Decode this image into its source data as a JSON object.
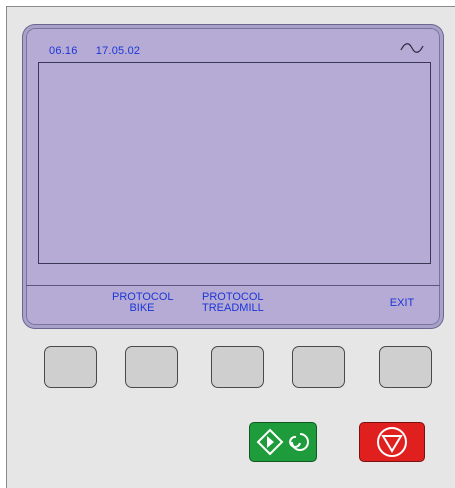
{
  "status": {
    "time": "06.16",
    "date": "17.05.02",
    "wave_icon": "sine-wave-icon"
  },
  "softkeys": [
    {
      "line1": "",
      "line2": ""
    },
    {
      "line1": "PROTOCOL",
      "line2": "BIKE"
    },
    {
      "line1": "PROTOCOL",
      "line2": "TREADMILL"
    },
    {
      "line1": "",
      "line2": ""
    },
    {
      "line1": "EXIT",
      "line2": ""
    }
  ],
  "buttons": {
    "start_icon": "start-diamond-icon",
    "start_color": "#1e9b3a",
    "stop_icon": "stop-triangle-icon",
    "stop_color": "#e0201e"
  },
  "colors": {
    "screen": "#b6abd4",
    "text": "#1b36d8"
  }
}
